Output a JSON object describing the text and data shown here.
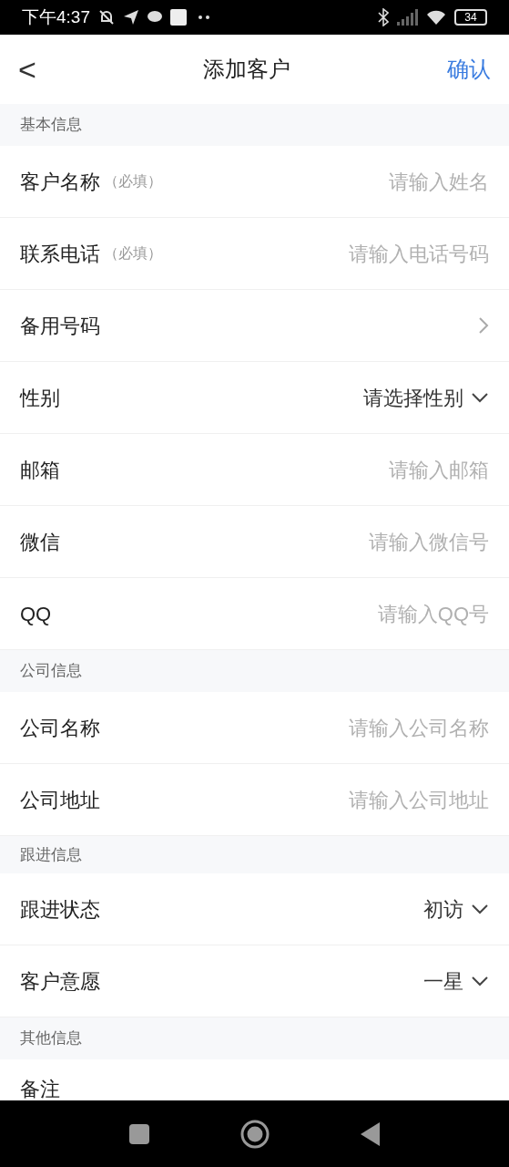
{
  "status_bar": {
    "time": "下午4:37",
    "battery": "34"
  },
  "header": {
    "back": "<",
    "title": "添加客户",
    "confirm": "确认"
  },
  "sections": [
    {
      "title": "基本信息",
      "rows": [
        {
          "kind": "input",
          "label": "客户名称",
          "note": "（必填）",
          "placeholder": "请输入姓名"
        },
        {
          "kind": "input",
          "label": "联系电话",
          "note": "（必填）",
          "placeholder": "请输入电话号码"
        },
        {
          "kind": "link",
          "label": "备用号码"
        },
        {
          "kind": "select",
          "label": "性别",
          "value": "请选择性别"
        },
        {
          "kind": "input",
          "label": "邮箱",
          "placeholder": "请输入邮箱"
        },
        {
          "kind": "input",
          "label": "微信",
          "placeholder": "请输入微信号"
        },
        {
          "kind": "input",
          "label": "QQ",
          "placeholder": "请输入QQ号"
        }
      ]
    },
    {
      "title": "公司信息",
      "rows": [
        {
          "kind": "input",
          "label": "公司名称",
          "placeholder": "请输入公司名称"
        },
        {
          "kind": "input",
          "label": "公司地址",
          "placeholder": "请输入公司地址"
        }
      ]
    },
    {
      "title": "跟进信息",
      "rows": [
        {
          "kind": "select",
          "label": "跟进状态",
          "value": "初访"
        },
        {
          "kind": "select",
          "label": "客户意愿",
          "value": "一星"
        }
      ]
    },
    {
      "title": "其他信息",
      "rows": [
        {
          "kind": "plain",
          "label": "备注"
        }
      ]
    }
  ]
}
